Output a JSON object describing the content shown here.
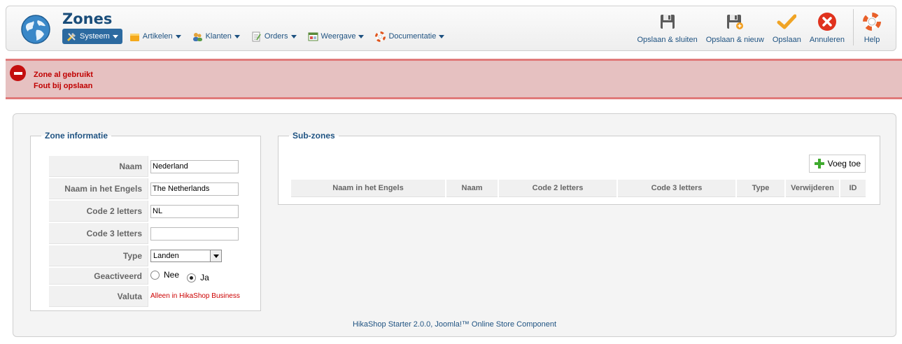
{
  "header": {
    "title": "Zones",
    "menus": [
      {
        "label": "Systeem",
        "icon": "tools-icon",
        "active": true
      },
      {
        "label": "Artikelen",
        "icon": "box-icon"
      },
      {
        "label": "Klanten",
        "icon": "users-icon"
      },
      {
        "label": "Orders",
        "icon": "orders-icon"
      },
      {
        "label": "Weergave",
        "icon": "display-icon"
      },
      {
        "label": "Documentatie",
        "icon": "lifebuoy-icon"
      }
    ],
    "toolbar": {
      "save_close": "Opslaan & sluiten",
      "save_new": "Opslaan & nieuw",
      "save": "Opslaan",
      "cancel": "Annuleren",
      "help": "Help"
    }
  },
  "errors": [
    "Zone al gebruikt",
    "Fout bij opslaan"
  ],
  "zone_info": {
    "legend": "Zone informatie",
    "fields": {
      "name_label": "Naam",
      "name_value": "Nederland",
      "name_en_label": "Naam in het Engels",
      "name_en_value": "The Netherlands",
      "code2_label": "Code 2 letters",
      "code2_value": "NL",
      "code3_label": "Code 3 letters",
      "code3_value": "",
      "type_label": "Type",
      "type_value": "Landen",
      "active_label": "Geactiveerd",
      "active_no": "Nee",
      "active_yes": "Ja",
      "active_selected": "Ja",
      "currency_label": "Valuta",
      "currency_note": "Alleen in HikaShop Business"
    }
  },
  "sub_zones": {
    "legend": "Sub-zones",
    "add_button": "Voeg toe",
    "columns": [
      "Naam in het Engels",
      "Naam",
      "Code 2 letters",
      "Code 3 letters",
      "Type",
      "Verwijderen",
      "ID"
    ]
  },
  "footer": "HikaShop Starter 2.0.0, Joomla!™ Online Store Component",
  "colors": {
    "accent": "#1e5281",
    "error_bg": "#e6c1c1",
    "error_text": "#c00000",
    "menu_active": "#2c6aa0"
  }
}
